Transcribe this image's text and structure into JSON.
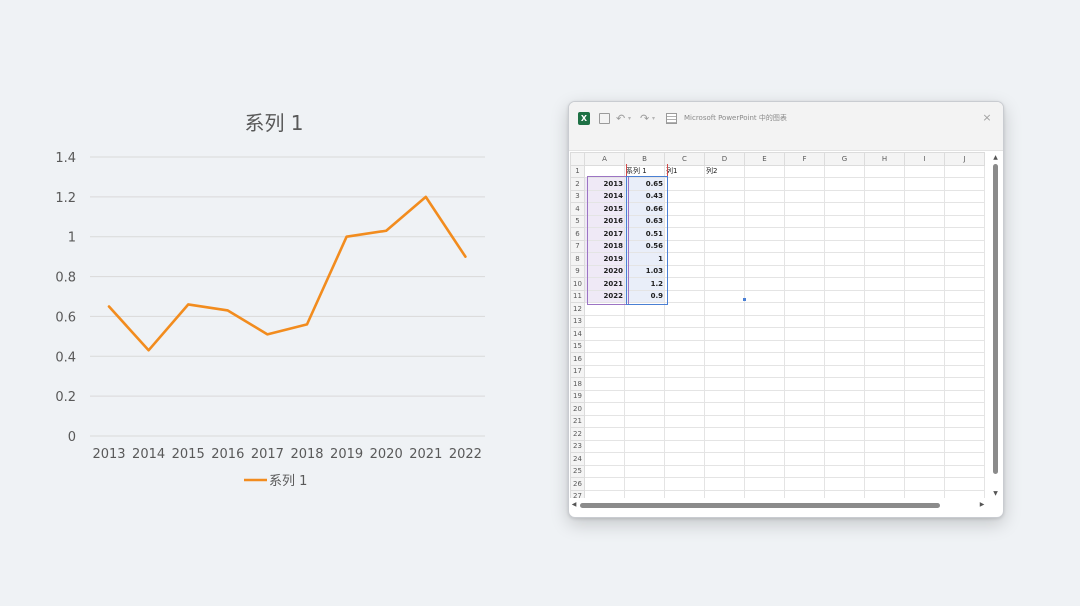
{
  "chart_data": {
    "type": "line",
    "title": "系列 1",
    "categories": [
      "2013",
      "2014",
      "2015",
      "2016",
      "2017",
      "2018",
      "2019",
      "2020",
      "2021",
      "2022"
    ],
    "series": [
      {
        "name": "系列 1",
        "values": [
          0.65,
          0.43,
          0.66,
          0.63,
          0.51,
          0.56,
          1,
          1.03,
          1.2,
          0.9
        ],
        "color": "#f28c1e"
      }
    ],
    "ylim": [
      0,
      1.4
    ],
    "yticks": [
      "0",
      "0.2",
      "0.4",
      "0.6",
      "0.8",
      "1",
      "1.2",
      "1.4"
    ],
    "grid": true,
    "legend_position": "bottom"
  },
  "excel": {
    "window_title": "Microsoft PowerPoint 中的图表",
    "app_icon": "excel-icon",
    "title_icons": [
      "save-icon",
      "undo-icon",
      "redo-icon",
      "sheet-icon"
    ],
    "close_glyph": "×",
    "columns": [
      "A",
      "B",
      "C",
      "D",
      "E",
      "F",
      "G",
      "H",
      "I",
      "J"
    ],
    "row_numbers": [
      "1",
      "2",
      "3",
      "4",
      "5",
      "6",
      "7",
      "8",
      "9",
      "10",
      "11",
      "12",
      "13",
      "14",
      "15",
      "16",
      "17",
      "18",
      "19",
      "20",
      "21",
      "22",
      "23",
      "24",
      "25",
      "26",
      "27"
    ],
    "header_row": [
      "",
      "系列 1",
      "列1",
      "列2"
    ],
    "data_rows": [
      [
        "2013",
        "0.65"
      ],
      [
        "2014",
        "0.43"
      ],
      [
        "2015",
        "0.66"
      ],
      [
        "2016",
        "0.63"
      ],
      [
        "2017",
        "0.51"
      ],
      [
        "2018",
        "0.56"
      ],
      [
        "2019",
        "1"
      ],
      [
        "2020",
        "1.03"
      ],
      [
        "2021",
        "1.2"
      ],
      [
        "2022",
        "0.9"
      ]
    ],
    "accent_color": "#1e7145"
  }
}
